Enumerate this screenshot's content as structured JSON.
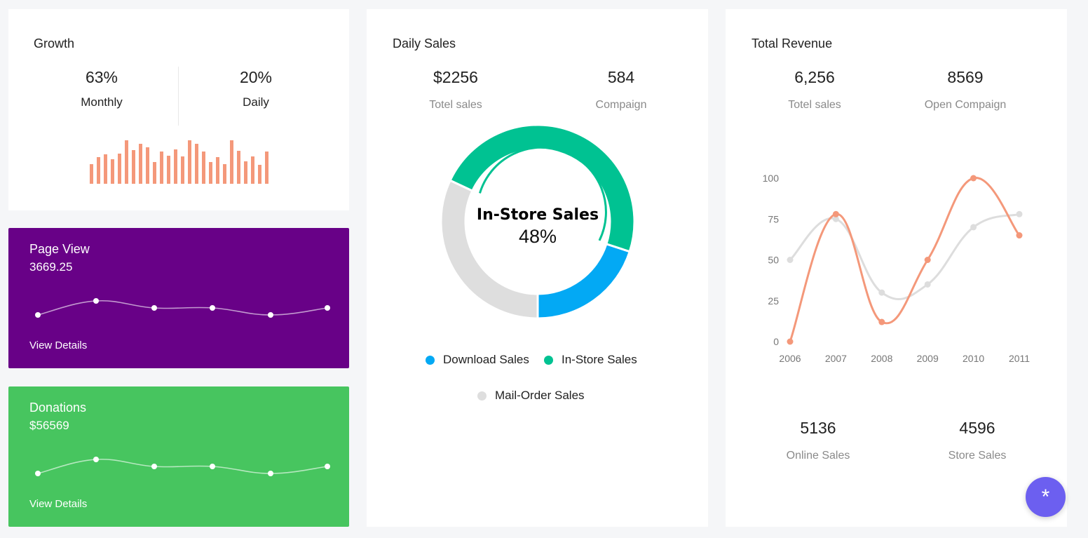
{
  "growth": {
    "title": "Growth",
    "monthly_value": "63%",
    "monthly_label": "Monthly",
    "daily_value": "20%",
    "daily_label": "Daily",
    "bars": [
      28,
      38,
      42,
      35,
      43,
      62,
      48,
      57,
      52,
      31,
      46,
      40,
      49,
      39,
      62,
      57,
      46,
      31,
      38,
      28,
      62,
      47,
      32,
      39,
      27,
      46
    ],
    "bar_color": "#f4987a"
  },
  "page_view": {
    "title": "Page View",
    "value": "3669.25",
    "link": "View Details",
    "spark": [
      8,
      28,
      18,
      18,
      8,
      18
    ],
    "bg": "#680187"
  },
  "donations": {
    "title": "Donations",
    "value": "$56569",
    "link": "View Details",
    "spark": [
      8,
      28,
      18,
      18,
      8,
      18
    ],
    "bg": "#47c55f"
  },
  "daily_sales": {
    "title": "Daily Sales",
    "stat1_value": "$2256",
    "stat1_label": "Totel sales",
    "stat2_value": "584",
    "stat2_label": "Compaign",
    "center_label": "In-Store Sales",
    "center_value": "48%",
    "legend": [
      {
        "label": "Download Sales",
        "color": "#03a9f4"
      },
      {
        "label": "In-Store Sales",
        "color": "#00c292"
      },
      {
        "label": "Mail-Order Sales",
        "color": "#dedede"
      }
    ],
    "chart_data": {
      "type": "pie",
      "donut": true,
      "slices": [
        {
          "name": "Download Sales",
          "value": 20,
          "color": "#03a9f4"
        },
        {
          "name": "In-Store Sales",
          "value": 48,
          "color": "#00c292"
        },
        {
          "name": "Mail-Order Sales",
          "value": 32,
          "color": "#dedede"
        }
      ]
    }
  },
  "total_revenue": {
    "title": "Total Revenue",
    "stat1_value": "6,256",
    "stat1_label": "Totel sales",
    "stat2_value": "8569",
    "stat2_label": "Open Compaign",
    "stat3_value": "5136",
    "stat3_label": "Online Sales",
    "stat4_value": "4596",
    "stat4_label": "Store Sales",
    "chart_data": {
      "type": "line",
      "x": [
        "2006",
        "2007",
        "2008",
        "2009",
        "2010",
        "2011"
      ],
      "yticks": [
        "0",
        "25",
        "50",
        "75",
        "100"
      ],
      "ylim": [
        0,
        100
      ],
      "series": [
        {
          "values": [
            0,
            78,
            12,
            50,
            100,
            65
          ],
          "color": "#f4987a"
        },
        {
          "values": [
            50,
            75,
            30,
            35,
            70,
            78
          ],
          "color": "#dddddd"
        }
      ],
      "grid": false
    }
  },
  "fab": {
    "icon": "asterisk-icon",
    "glyph": "*"
  }
}
